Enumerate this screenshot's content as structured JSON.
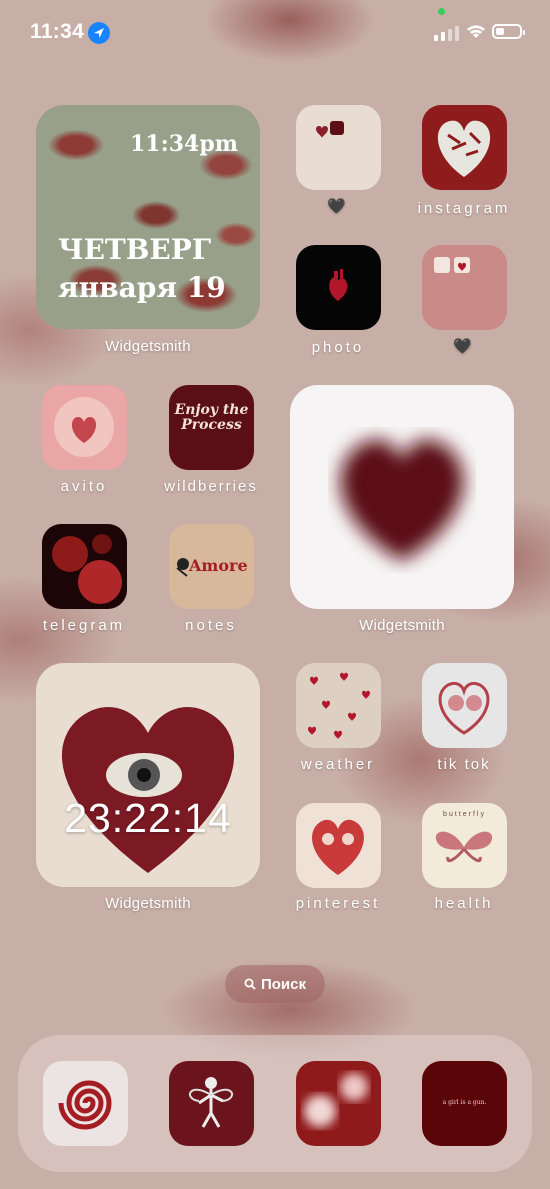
{
  "status_bar": {
    "time": "11:34"
  },
  "widgets": {
    "date_widget": {
      "time": "11:34pm",
      "weekday": "ЧЕТВЕРГ",
      "date": "января 19",
      "label": "Widgetsmith"
    },
    "heart_widget": {
      "label": "Widgetsmith"
    },
    "clock_widget": {
      "time": "23:22:14",
      "label": "Widgetsmith"
    }
  },
  "apps": [
    {
      "label": "🖤"
    },
    {
      "label": "instagram"
    },
    {
      "label": "photo"
    },
    {
      "label": "🖤"
    },
    {
      "label": "avito"
    },
    {
      "label": "wildberries"
    },
    {
      "label": "telegram"
    },
    {
      "label": "notes"
    },
    {
      "label": "weather"
    },
    {
      "label": "tik tok"
    },
    {
      "label": "pinterest"
    },
    {
      "label": "health"
    }
  ],
  "icon_art": {
    "wildberries": "Enjoy the Process",
    "notes": "Amore",
    "health": "butterfly",
    "dock4": "a girl is a gun."
  },
  "search": {
    "label": "Поиск"
  },
  "colors": {
    "accent": "#6e1a1e",
    "background": "#c7aea6"
  }
}
